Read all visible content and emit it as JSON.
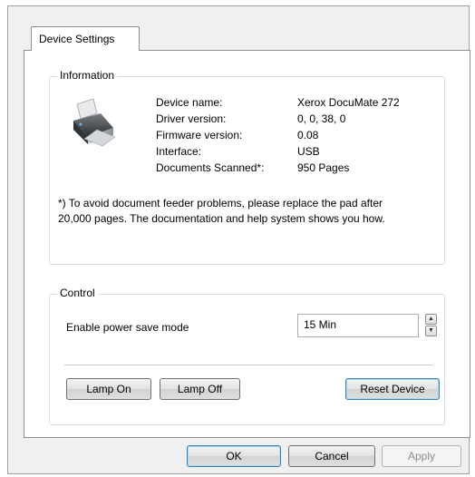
{
  "tabs": [
    {
      "label": "Device Settings"
    }
  ],
  "information": {
    "title": "Information",
    "rows": [
      {
        "label": "Device name:",
        "value": "Xerox DocuMate 272"
      },
      {
        "label": "Driver version:",
        "value": "0, 0, 38, 0"
      },
      {
        "label": "Firmware version:",
        "value": "0.08"
      },
      {
        "label": "Interface:",
        "value": "USB"
      },
      {
        "label": "Documents Scanned*:",
        "value": "950 Pages"
      }
    ],
    "note_line1": "*)  To avoid document feeder problems, please replace the pad after",
    "note_line2": "20,000 pages. The documentation and help system shows you how."
  },
  "control": {
    "title": "Control",
    "power_save_label": "Enable power save mode",
    "power_save_value": "15 Min",
    "lamp_on_label": "Lamp On",
    "lamp_off_label": "Lamp Off",
    "reset_label": "Reset Device"
  },
  "footer": {
    "ok_label": "OK",
    "cancel_label": "Cancel",
    "apply_label": "Apply"
  },
  "icons": {
    "scanner": "scanner-icon",
    "spin_up": "spin-up-icon",
    "spin_down": "spin-down-icon"
  }
}
